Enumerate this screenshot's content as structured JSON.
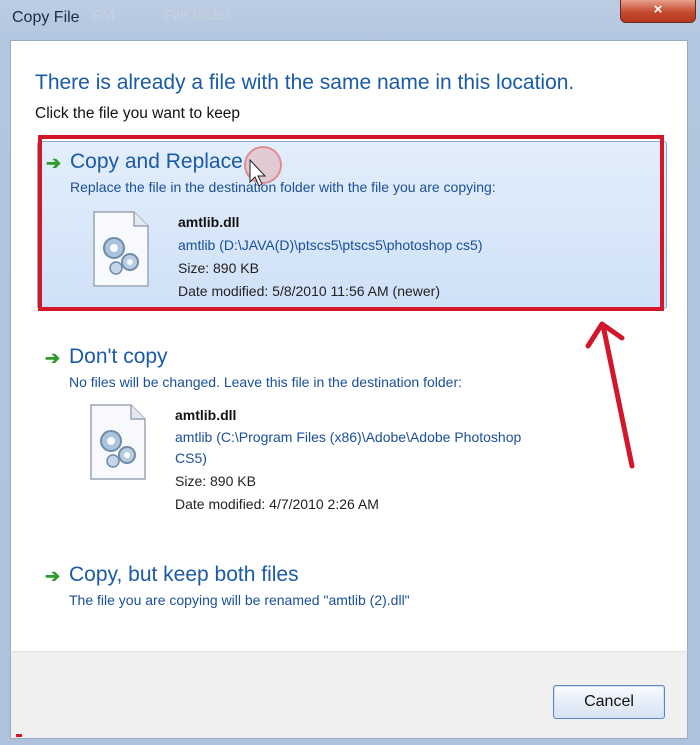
{
  "window": {
    "title": "Copy File",
    "ghost_text_1": "PM",
    "ghost_text_2": "File folder",
    "close_glyph": "×"
  },
  "header": {
    "heading": "There is already a file with the same name in this location.",
    "subheading": "Click the file you want to keep"
  },
  "options": [
    {
      "title": "Copy and Replace",
      "description": "Replace the file in the destination folder with the file you are copying:",
      "file": {
        "name": "amtlib.dll",
        "location": "amtlib (D:\\JAVA(D)\\ptscs5\\ptscs5\\photoshop cs5)",
        "size": "Size: 890 KB",
        "modified": "Date modified: 5/8/2010 11:56 AM (newer)"
      },
      "selected": true
    },
    {
      "title": "Don't copy",
      "description": "No files will be changed. Leave this file in the destination folder:",
      "file": {
        "name": "amtlib.dll",
        "location_line1": "amtlib (C:\\Program Files (x86)\\Adobe\\Adobe Photoshop",
        "location_line2": "CS5)",
        "size": "Size: 890 KB",
        "modified": "Date modified: 4/7/2010 2:26 AM"
      },
      "selected": false
    },
    {
      "title": "Copy, but keep both files",
      "description": "The file you are copying will be renamed \"amtlib (2).dll\"",
      "selected": false
    }
  ],
  "footer": {
    "cancel_label": "Cancel"
  },
  "colors": {
    "annotation": "#d3172b",
    "link_blue": "#1a5aa6",
    "arrow_green": "#2e9b2e"
  },
  "icons": [
    "arrow-right-icon",
    "dll-file-icon",
    "close-icon"
  ]
}
